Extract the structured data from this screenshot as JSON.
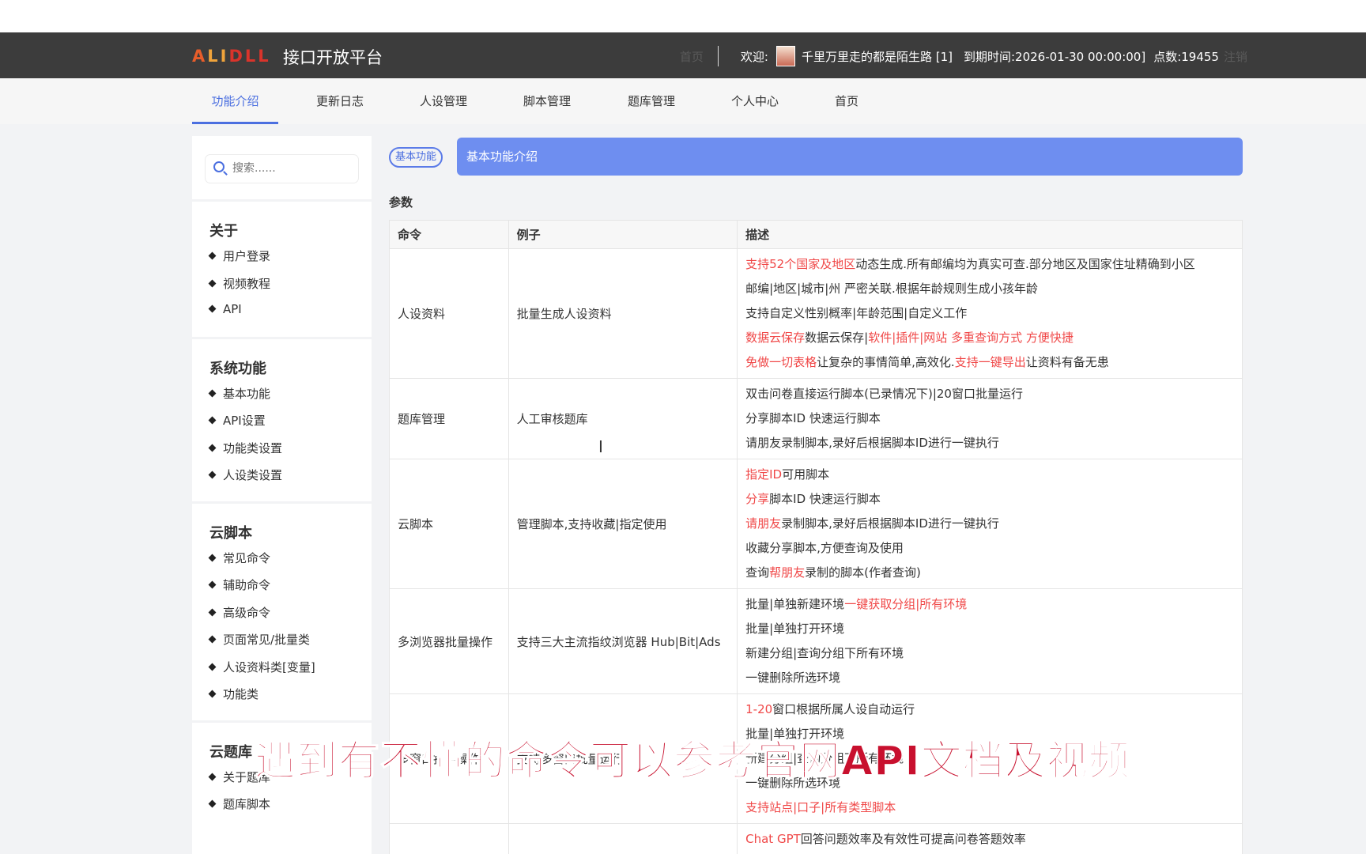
{
  "header": {
    "logo": [
      "A",
      "LI",
      "DLL"
    ],
    "app_title": "接口开放平台",
    "home_link": "首页",
    "welcome": "欢迎:",
    "user_name": "千里万里走的都是陌生路 [1]",
    "expire": "到期时间:2026-01-30 00:00:00]",
    "points": "点数:19455",
    "logout": "注销"
  },
  "nav": {
    "items": [
      "功能介绍",
      "更新日志",
      "人设管理",
      "脚本管理",
      "题库管理",
      "个人中心",
      "首页"
    ],
    "active": "功能介绍"
  },
  "sidebar": {
    "search_placeholder": "搜索......",
    "sections": [
      {
        "title": "关于",
        "items": [
          "用户登录",
          "视频教程",
          "API"
        ]
      },
      {
        "title": "系统功能",
        "items": [
          "基本功能",
          "API设置",
          "功能类设置",
          "人设类设置"
        ]
      },
      {
        "title": "云脚本",
        "items": [
          "常见命令",
          "辅助命令",
          "高级命令",
          "页面常见/批量类",
          "人设资料类[变量]",
          "功能类"
        ]
      },
      {
        "title": "云题库",
        "items": [
          "关于题库",
          "题库脚本"
        ]
      }
    ]
  },
  "main": {
    "tag": "基本功能",
    "banner": "基本功能介绍",
    "params_label": "参数",
    "columns": [
      "命令",
      "例子",
      "描述"
    ],
    "rows": [
      {
        "command": "人设资料",
        "example": "批量生成人设资料",
        "desc": [
          [
            [
              "支持52个国家及地区",
              "red"
            ],
            [
              "动态生成.所有邮编均为真实可查.部分地区及国家住址精确到小区",
              ""
            ]
          ],
          [
            [
              "邮编|地区|城市|州 严密关联.根据年龄规则生成小孩年龄",
              ""
            ]
          ],
          [
            [
              "支持自定义性别概率|年龄范围|自定义工作",
              ""
            ]
          ],
          [
            [
              "数据云保存",
              "red"
            ],
            [
              "数据云保存|",
              ""
            ],
            [
              "软件|插件|网站 多重查询方式 方便快捷",
              "red"
            ]
          ],
          [
            [
              "免做一切表格",
              "red"
            ],
            [
              "让复杂的事情简单,高效化.",
              ""
            ],
            [
              "支持一键导出",
              "red"
            ],
            [
              "让资料有备无患",
              ""
            ]
          ]
        ]
      },
      {
        "command": "题库管理",
        "example": "人工审核题库",
        "desc": [
          [
            [
              "双击问卷直接运行脚本(已录情况下)|20窗口批量运行",
              ""
            ]
          ],
          [
            [
              "分享脚本ID 快速运行脚本",
              ""
            ]
          ],
          [
            [
              "请朋友录制脚本,录好后根据脚本ID进行一键执行",
              ""
            ]
          ]
        ]
      },
      {
        "command": "云脚本",
        "example": "管理脚本,支持收藏|指定使用",
        "desc": [
          [
            [
              "指定ID",
              "red"
            ],
            [
              "可用脚本",
              ""
            ]
          ],
          [
            [
              "分享",
              "red"
            ],
            [
              "脚本ID 快速运行脚本",
              ""
            ]
          ],
          [
            [
              "请朋友",
              "red"
            ],
            [
              "录制脚本,录好后根据脚本ID进行一键执行",
              ""
            ]
          ],
          [
            [
              "收藏分享脚本,方便查询及使用",
              ""
            ]
          ],
          [
            [
              "查询",
              ""
            ],
            [
              "帮朋友",
              "red"
            ],
            [
              "录制的脚本(作者查询)",
              ""
            ]
          ]
        ]
      },
      {
        "command": "多浏览器批量操作",
        "example": "支持三大主流指纹浏览器 Hub|Bit|Ads",
        "desc": [
          [
            [
              "批量|单独新建环境",
              ""
            ],
            [
              "一键获取分组|所有环境",
              "red"
            ]
          ],
          [
            [
              "批量|单独打开环境",
              ""
            ]
          ],
          [
            [
              "新建分组|查询分组下所有环境",
              ""
            ]
          ],
          [
            [
              "一键删除所选环境",
              ""
            ]
          ]
        ]
      },
      {
        "command": "多窗口批量操作",
        "example": "支持多窗口批量运行",
        "desc": [
          [
            [
              "1-20",
              "red"
            ],
            [
              "窗口根据所属人设自动运行",
              ""
            ]
          ],
          [
            [
              "批量|单独打开环境",
              ""
            ]
          ],
          [
            [
              "新建分组|查询分组下所有环境",
              ""
            ]
          ],
          [
            [
              "一键删除所选环境",
              ""
            ]
          ],
          [
            [
              "支持站点|口子|所有类型脚本",
              "red"
            ]
          ]
        ]
      },
      {
        "command": "",
        "example": "",
        "desc": [
          [
            [
              "Chat GPT",
              "red"
            ],
            [
              "回答问题效率及有效性可提高问卷答题效率",
              ""
            ]
          ]
        ]
      }
    ]
  },
  "caption": "遇到有不懂的命令可以参考官网API文档及视频",
  "colors": {
    "accent": "#4b6fe0",
    "banner": "#6e8ef0",
    "header": "#3c3c3c",
    "highlight": "#f04848",
    "caption": "#c8102e"
  }
}
